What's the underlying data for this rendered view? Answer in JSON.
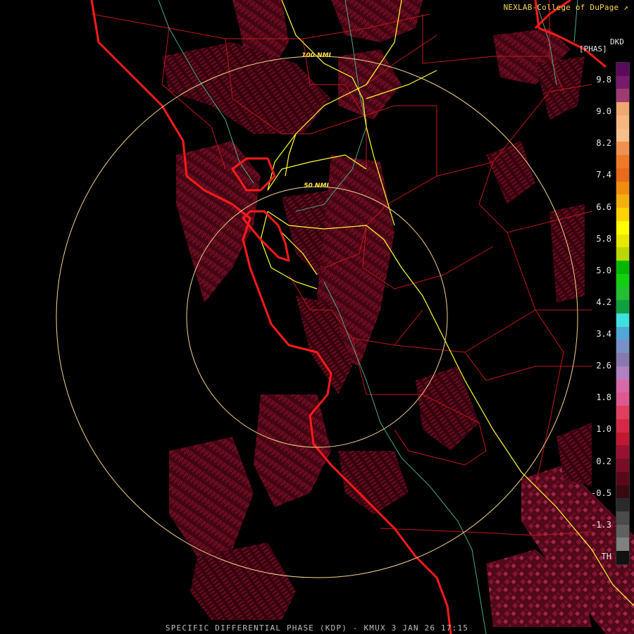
{
  "header": {
    "credit": "NEXLAB-College of DuPage",
    "credit_icon": "external-link-icon",
    "product_code": "DKD",
    "units": "[PHAS]"
  },
  "footer": {
    "caption": "SPECIFIC DIFFERENTIAL PHASE (KDP) - KMUX 3 JAN 26 17:15"
  },
  "range_rings": [
    {
      "label": "50 NMI"
    },
    {
      "label": "100 NMI"
    }
  ],
  "color_scale": {
    "labels": [
      "9.8",
      "9.0",
      "8.2",
      "7.4",
      "6.6",
      "5.8",
      "5.0",
      "4.2",
      "3.4",
      "2.6",
      "1.8",
      "1.0",
      "0.2",
      "-0.5",
      "-1.3",
      "TH"
    ],
    "colors": [
      "#5a0a5a",
      "#7a1a6a",
      "#a03a70",
      "#f0a870",
      "#f5b77f",
      "#f7c08a",
      "#f29050",
      "#ee7a28",
      "#e86a1a",
      "#f08c10",
      "#f4b010",
      "#ffd200",
      "#ffff00",
      "#e8e800",
      "#b8d800",
      "#00b800",
      "#10d010",
      "#20c030",
      "#10a040",
      "#40e0e0",
      "#50a8d8",
      "#7890c8",
      "#8878b0",
      "#b080c0",
      "#d868a8",
      "#e05890",
      "#e04060",
      "#d82848",
      "#c01830",
      "#9a1030",
      "#7a0c28",
      "#5a0818",
      "#3a0810",
      "#2a2a2a",
      "#4a4a4a",
      "#606060",
      "#808080",
      "#111111"
    ]
  },
  "colors": {
    "coast": "#ff1a1a",
    "borders": "#c01818",
    "highways": "#ffff33",
    "rivers": "#4fb89a",
    "rings": "#f5d28a",
    "echo": "#7a0c22"
  }
}
